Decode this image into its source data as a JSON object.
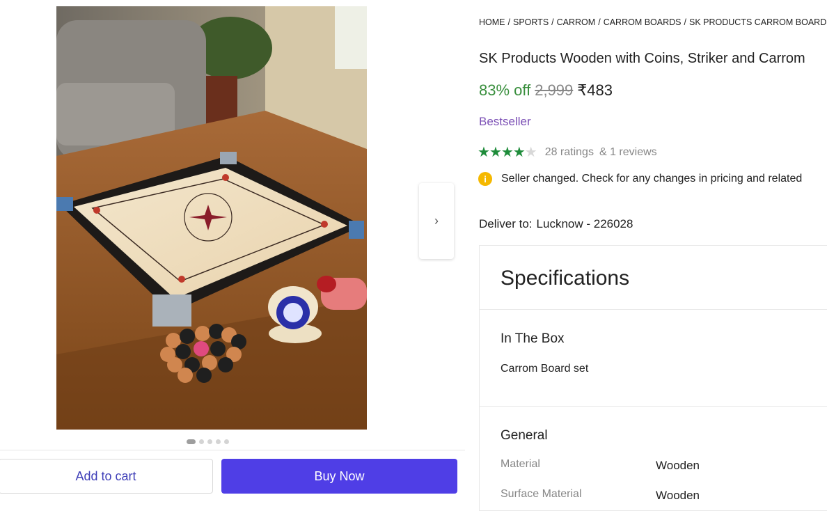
{
  "breadcrumb": [
    "HOME",
    "SPORTS",
    "CARROM",
    "CARROM BOARDS",
    "SK PRODUCTS CARROM BOARDS"
  ],
  "product": {
    "title": "SK Products Wooden with Coins, Striker and Carrom",
    "discount": "83% off",
    "mrp": "2,999",
    "price": "₹483",
    "badge": "Bestseller",
    "rating": 4,
    "rating_max": 5,
    "ratings_count_text": "28 ratings",
    "reviews_text": "& 1 reviews",
    "seller_notice": "Seller changed. Check for any changes in pricing and related",
    "deliver_label": "Deliver to:",
    "deliver_location": "Lucknow - 226028"
  },
  "carousel": {
    "slides": 5,
    "active": 1
  },
  "actions": {
    "add_to_cart": "Add to cart",
    "buy_now": "Buy Now"
  },
  "specifications": {
    "title": "Specifications",
    "in_the_box": {
      "heading": "In The Box",
      "text": "Carrom Board set"
    },
    "general": {
      "heading": "General",
      "rows": [
        {
          "key": "Material",
          "value": "Wooden"
        },
        {
          "key": "Surface Material",
          "value": "Wooden"
        }
      ]
    }
  },
  "colors": {
    "discount_green": "#388e3c",
    "buy_button": "#4f3ee6",
    "bestseller_purple": "#7b4fb5",
    "star_green": "#1e8c3a",
    "info_yellow": "#f5b800"
  }
}
